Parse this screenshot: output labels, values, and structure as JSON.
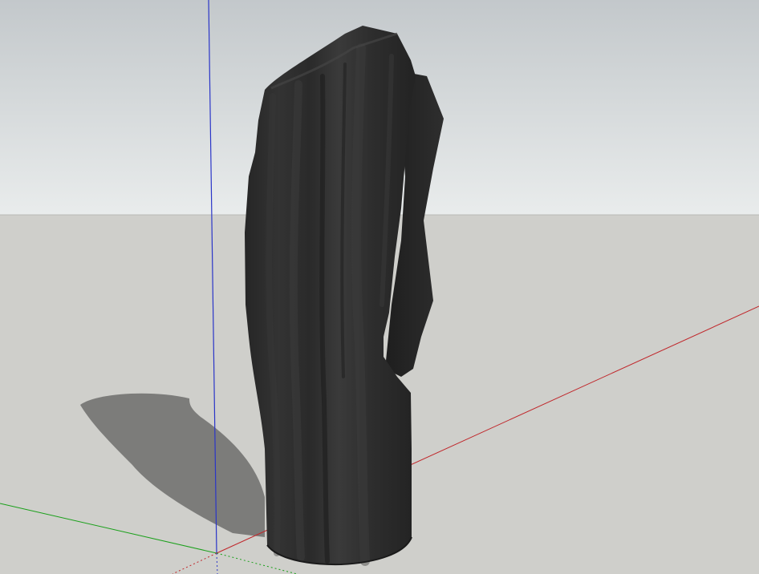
{
  "viewport": {
    "view_mode": "perspective",
    "sky_color_top": "#c3c8cb",
    "sky_color_horizon": "#e8ebec",
    "ground_color": "#cfcfcb",
    "axes": {
      "red_axis_color": "#c0262a",
      "green_axis_color": "#1aa01a",
      "blue_axis_color": "#2a35c8"
    },
    "model": {
      "name": "draped-column",
      "material_color": "#2f2f2f",
      "shadow_color": "#7c7c7a"
    }
  }
}
